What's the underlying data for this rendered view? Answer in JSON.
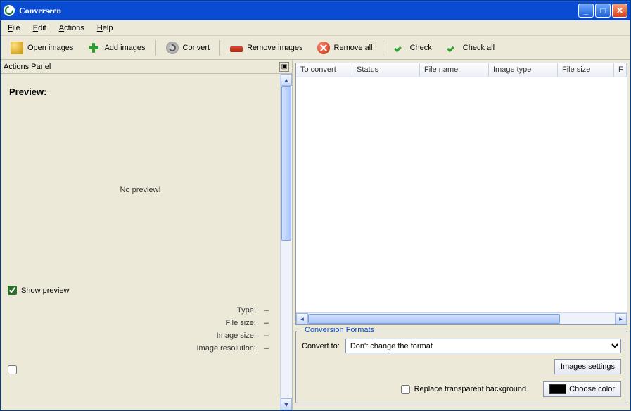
{
  "window": {
    "title": "Converseen"
  },
  "menu": {
    "file": "File",
    "edit": "Edit",
    "actions": "Actions",
    "help": "Help"
  },
  "toolbar": {
    "open": "Open images",
    "add": "Add images",
    "convert": "Convert",
    "remove": "Remove images",
    "remove_all": "Remove all",
    "check": "Check",
    "check_all": "Check all"
  },
  "actions_panel": {
    "title": "Actions Panel",
    "preview_label": "Preview:",
    "no_preview": "No preview!",
    "show_preview": "Show preview",
    "meta": {
      "type_label": "Type:",
      "type_value": "–",
      "file_size_label": "File size:",
      "file_size_value": "–",
      "image_size_label": "Image size:",
      "image_size_value": "–",
      "image_resolution_label": "Image resolution:",
      "image_resolution_value": "–"
    }
  },
  "file_list": {
    "cols": {
      "to_convert": "To convert",
      "status": "Status",
      "file_name": "File name",
      "image_type": "Image type",
      "file_size": "File size",
      "extra": "F"
    }
  },
  "formats": {
    "legend": "Conversion Formats",
    "convert_to_label": "Convert to:",
    "selected": "Don't change the format",
    "images_settings": "Images settings",
    "replace_bg": "Replace transparent background",
    "choose_color": "Choose color"
  }
}
